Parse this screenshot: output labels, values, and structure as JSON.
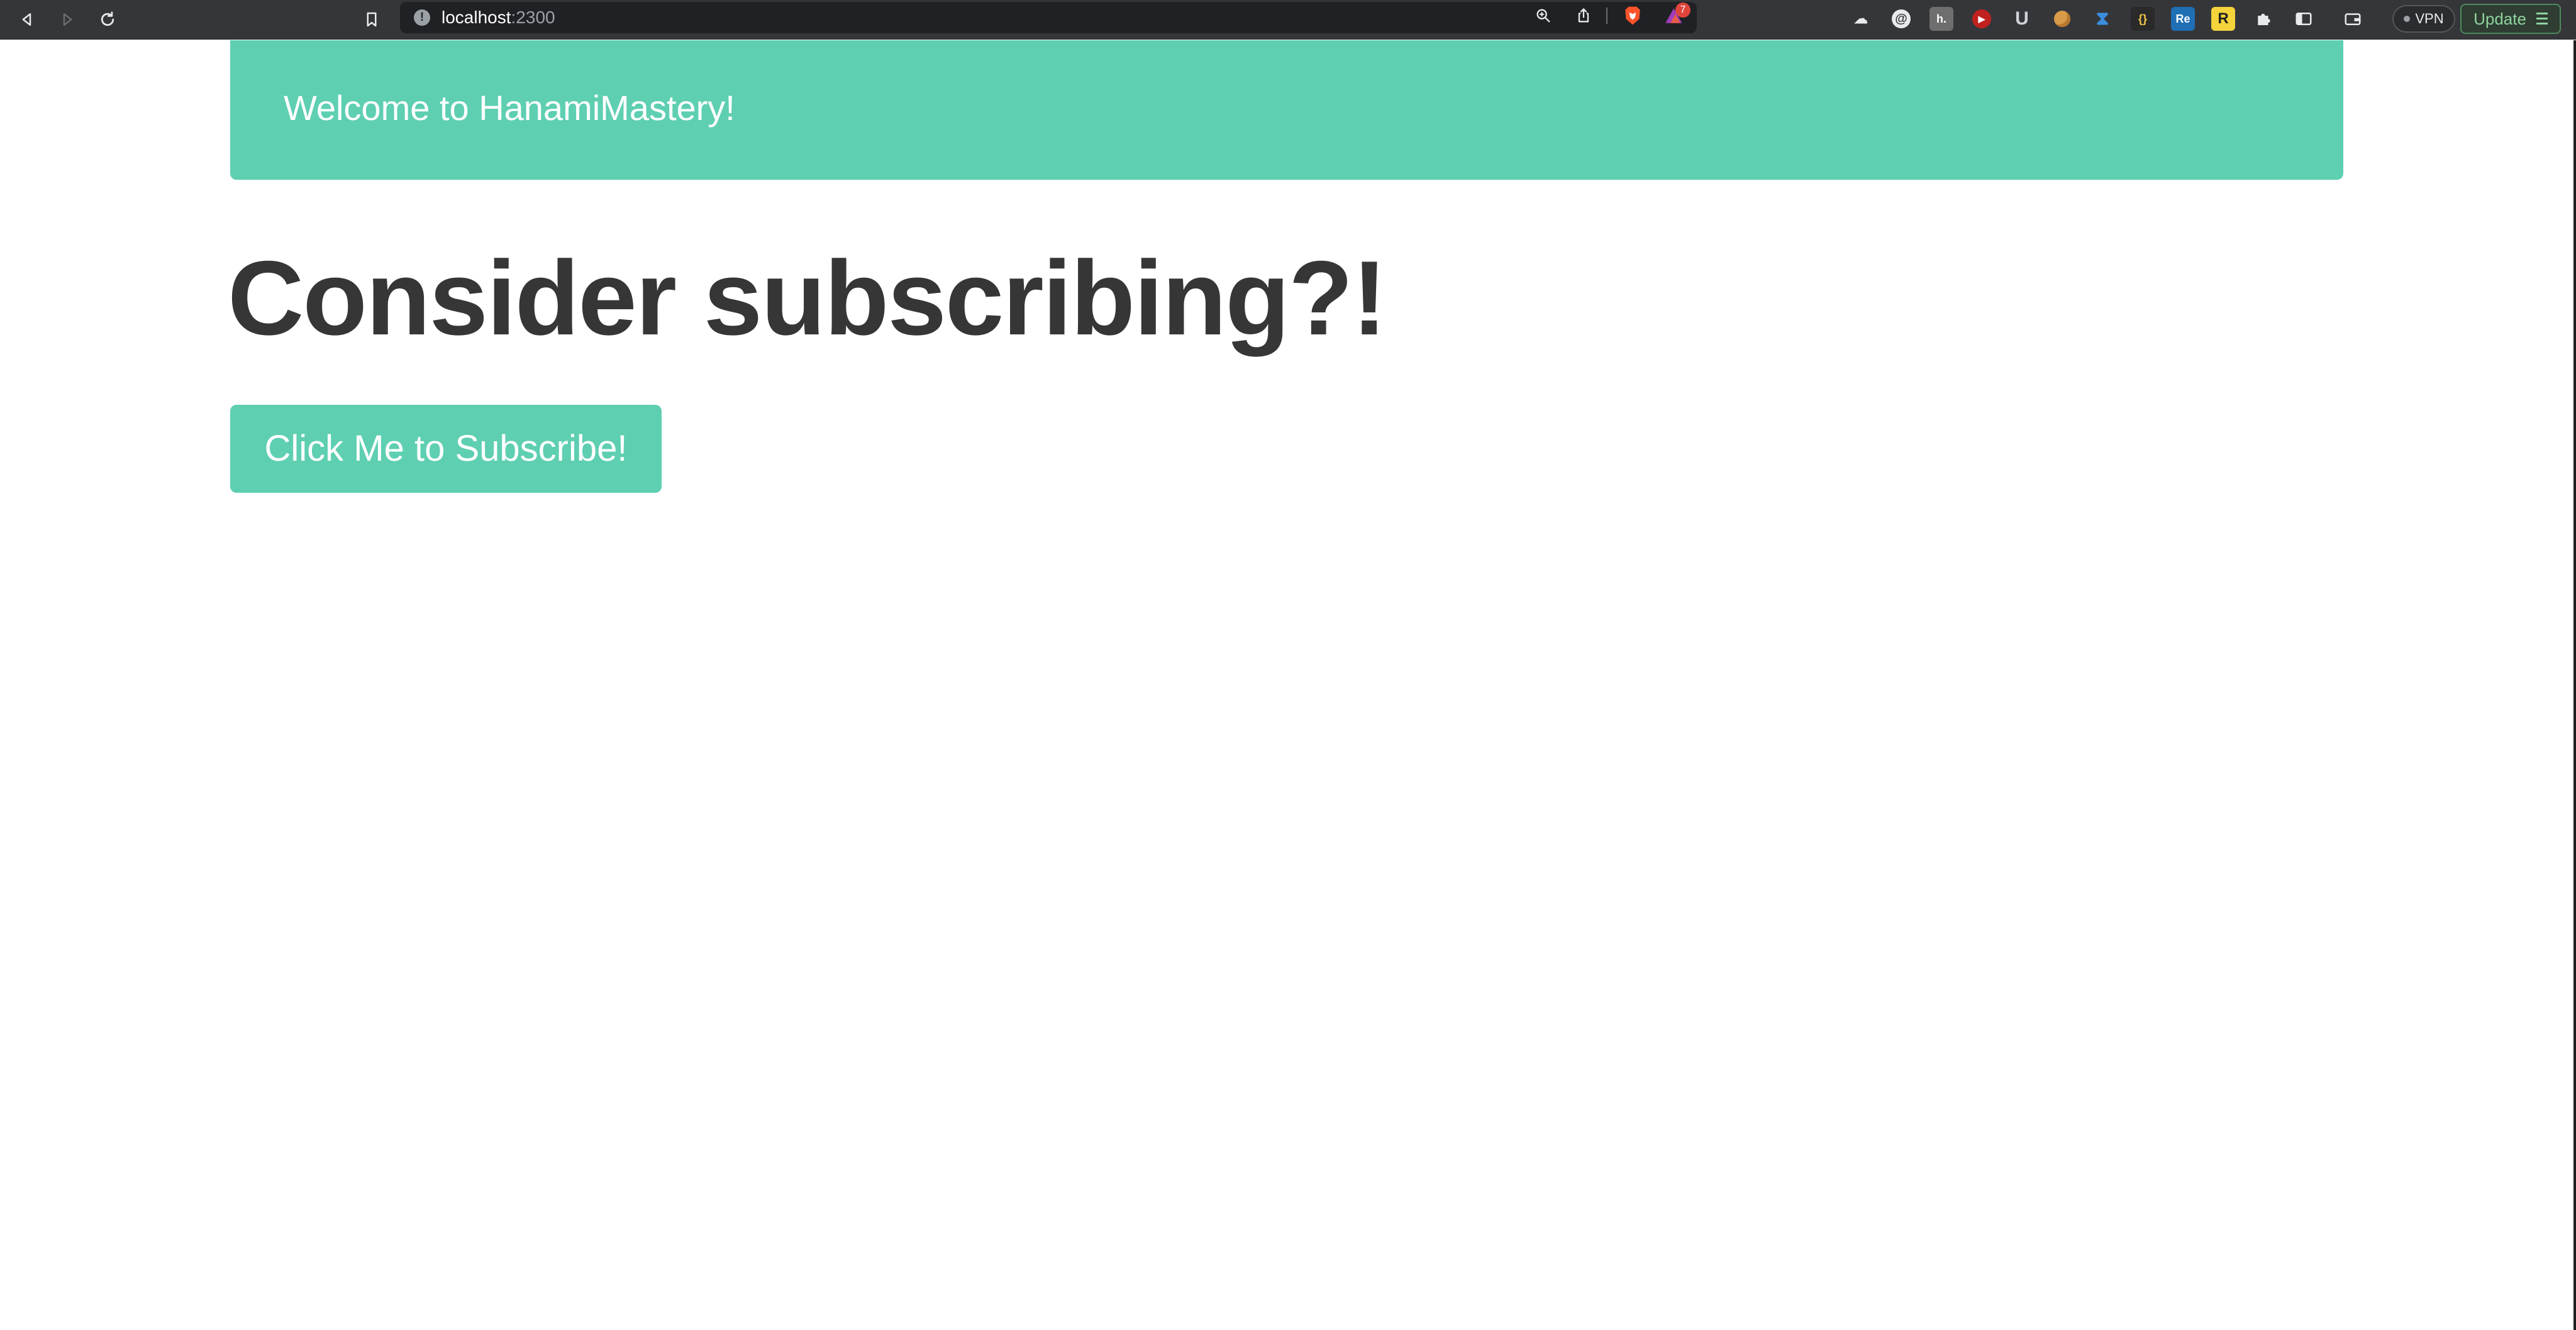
{
  "browser": {
    "url_host": "localhost",
    "url_port": ":2300",
    "rewards_badge_count": "7",
    "vpn_label": "VPN",
    "update_label": "Update",
    "nav_icons": [
      "back-icon",
      "forward-icon",
      "reload-icon",
      "bookmark-icon"
    ],
    "omnibox_icons": [
      "info-icon",
      "zoom-icon",
      "share-icon",
      "brave-shields-icon",
      "brave-rewards-icon"
    ],
    "extensions": [
      {
        "name": "cloud-extension-icon",
        "glyph": "☁",
        "color": "#35363a"
      },
      {
        "name": "vimeo-extension-icon",
        "glyph": "@",
        "color": "#35363a"
      },
      {
        "name": "hypothesis-extension-icon",
        "glyph": "h.",
        "color": "#6e6e6e"
      },
      {
        "name": "youtube-extension-icon",
        "glyph": "▶",
        "color": "#c0211f"
      },
      {
        "name": "u-extension-icon",
        "glyph": "U",
        "color": "#35363a"
      },
      {
        "name": "cookie-extension-icon",
        "glyph": "●",
        "color": "#35363a"
      },
      {
        "name": "hourglass-extension-icon",
        "glyph": "⧗",
        "color": "#35363a"
      },
      {
        "name": "json-extension-icon",
        "glyph": "{}",
        "color": "#2a2a2a"
      },
      {
        "name": "re-extension-icon",
        "glyph": "Re",
        "color": "#1f6fb5"
      },
      {
        "name": "r-extension-icon",
        "glyph": "R",
        "color": "#f5d33a"
      },
      {
        "name": "puzzle-extension-icon",
        "glyph": "✱",
        "color": "#35363a"
      }
    ]
  },
  "page": {
    "banner_text": "Welcome to HanamiMastery!",
    "headline": "Consider subscribing?!",
    "subscribe_button_label": "Click Me to Subscribe!"
  },
  "colors": {
    "accent": "#5ecfb1",
    "headline": "#363636",
    "chrome": "#35363a",
    "omnibox": "#202124"
  }
}
